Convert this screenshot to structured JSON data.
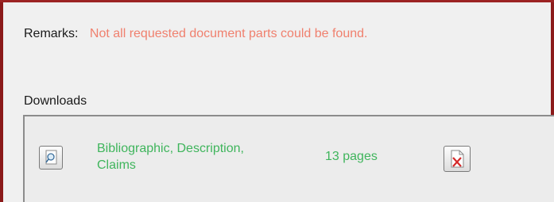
{
  "remarks": {
    "label": "Remarks:",
    "value": "Not all requested document parts could be found."
  },
  "downloads": {
    "label": "Downloads",
    "items": [
      {
        "parts_line1": "Bibliographic, Description,",
        "parts_line2": "Claims",
        "pages": "13 pages",
        "view_icon": "magnifier-document-icon",
        "delete_icon": "document-delete-icon"
      }
    ]
  },
  "colors": {
    "border": "#8b1a1a",
    "remark_text": "#f0806e",
    "download_text": "#3fb55c"
  }
}
